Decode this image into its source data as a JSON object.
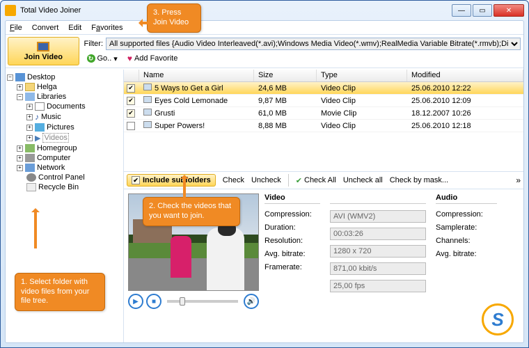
{
  "window": {
    "title": "Total Video Joiner"
  },
  "menu": {
    "file": "File",
    "convert": "Convert",
    "edit": "Edit",
    "favorites": "Favorites"
  },
  "toolbar": {
    "join_label": "Join Video",
    "filter_label": "Filter:",
    "filter_value": "All supported files {Audio Video Interleaved(*.avi);Windows Media Video(*.wmv);RealMedia Variable Bitrate(*.rmvb);Di",
    "go_label": "Go..",
    "addfav_label": "Add Favorite"
  },
  "tree": {
    "desktop": "Desktop",
    "helga": "Helga",
    "libraries": "Libraries",
    "documents": "Documents",
    "music": "Music",
    "pictures": "Pictures",
    "videos": "Videos",
    "homegroup": "Homegroup",
    "computer": "Computer",
    "network": "Network",
    "controlpanel": "Control Panel",
    "recyclebin": "Recycle Bin"
  },
  "list": {
    "hdr_name": "Name",
    "hdr_size": "Size",
    "hdr_type": "Type",
    "hdr_mod": "Modified",
    "rows": [
      {
        "checked": true,
        "name": "5 Ways to Get a Girl",
        "size": "24,6 MB",
        "type": "Video Clip",
        "mod": "25.06.2010 12:22",
        "selected": true
      },
      {
        "checked": true,
        "name": "Eyes Cold Lemonade",
        "size": "9,87 MB",
        "type": "Video Clip",
        "mod": "25.06.2010 12:09"
      },
      {
        "checked": true,
        "name": "Grusti",
        "size": "61,0 MB",
        "type": "Movie Clip",
        "mod": "18.12.2007 10:26"
      },
      {
        "checked": false,
        "name": "Super Powers!",
        "size": "8,88 MB",
        "type": "Video Clip",
        "mod": "25.06.2010 12:18"
      }
    ]
  },
  "tb2": {
    "include": "Include subfolders",
    "check": "Check",
    "uncheck": "Uncheck",
    "checkall": "Check All",
    "uncheckall": "Uncheck all",
    "bymask": "Check by mask..."
  },
  "props": {
    "video_head": "Video",
    "audio_head": "Audio",
    "compression_l": "Compression:",
    "duration_l": "Duration:",
    "resolution_l": "Resolution:",
    "avgbitrate_l": "Avg. bitrate:",
    "framerate_l": "Framerate:",
    "samplerate_l": "Samplerate:",
    "channels_l": "Channels:",
    "compression_v": "AVI (WMV2)",
    "duration_v": "00:03:26",
    "resolution_v": "1280 x 720",
    "avgbitrate_v": "871,00 kbit/s",
    "framerate_v": "25,00 fps"
  },
  "callouts": {
    "c1": "1. Select folder with video files from your file tree.",
    "c2": "2. Check the videos that you want to join.",
    "c3": "3. Press Join Video"
  }
}
